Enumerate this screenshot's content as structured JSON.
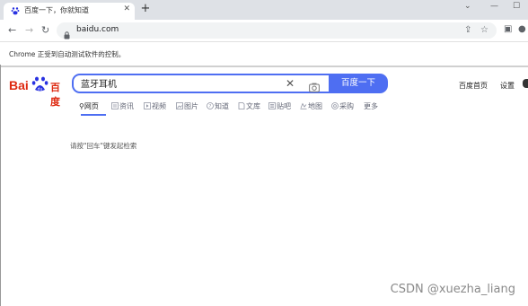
{
  "browser": {
    "tab_title": "百度一下，你就知道",
    "url": "baidu.com",
    "infobar_text": "Chrome 正受到自动测试软件的控制。"
  },
  "page": {
    "logo_latin": "Bai",
    "logo_cn": "百度",
    "search_value": "蓝牙耳机",
    "search_button": "百度一下",
    "top_links": [
      "百度首页",
      "设置"
    ],
    "nav_tabs": [
      "网页",
      "资讯",
      "视频",
      "图片",
      "知道",
      "文库",
      "贴吧",
      "地图",
      "采购",
      "更多"
    ],
    "hint": "请按\"回车\"键发起检索"
  },
  "watermark": "CSDN @xuezha_liang",
  "colors": {
    "accent": "#4e6ef2",
    "brand_red": "#de2910",
    "tabstrip": "#dee1e6"
  }
}
